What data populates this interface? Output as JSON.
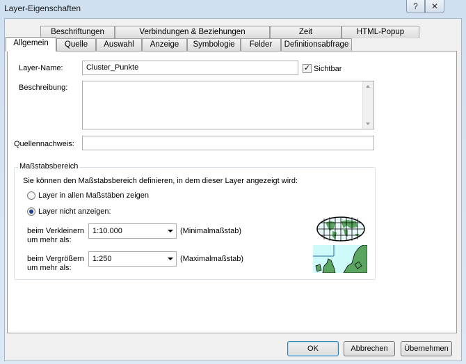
{
  "window": {
    "title": "Layer-Eigenschaften",
    "help": "?",
    "close": "✕"
  },
  "tabs_row1": [
    "Beschriftungen",
    "Verbindungen & Beziehungen",
    "Zeit",
    "HTML-Popup"
  ],
  "tabs_row2": [
    "Allgemein",
    "Quelle",
    "Auswahl",
    "Anzeige",
    "Symbologie",
    "Felder",
    "Definitionsabfrage"
  ],
  "general": {
    "layer_name_label": "Layer-Name:",
    "layer_name_value": "Cluster_Punkte",
    "visible_label": "Sichtbar",
    "visible_checked": true,
    "description_label": "Beschreibung:",
    "description_value": "",
    "credits_label": "Quellennachweis:",
    "credits_value": ""
  },
  "scale": {
    "group_title": "Maßstabsbereich",
    "intro": "Sie können den Maßstabsbereich definieren, in dem dieser Layer angezeigt wird:",
    "option_all": "Layer in allen Maßstäben zeigen",
    "option_hide": "Layer nicht anzeigen:",
    "selected": "option_hide",
    "min_label_1": "beim Verkleinern",
    "min_label_2": "um mehr als:",
    "min_value": "1:10.000",
    "min_hint": "(Minimalmaßstab)",
    "max_label_1": "beim Vergrößern",
    "max_label_2": "um mehr als:",
    "max_value": "1:250",
    "max_hint": "(Maximalmaßstab)"
  },
  "buttons": {
    "ok": "OK",
    "cancel": "Abbrechen",
    "apply": "Übernehmen"
  }
}
